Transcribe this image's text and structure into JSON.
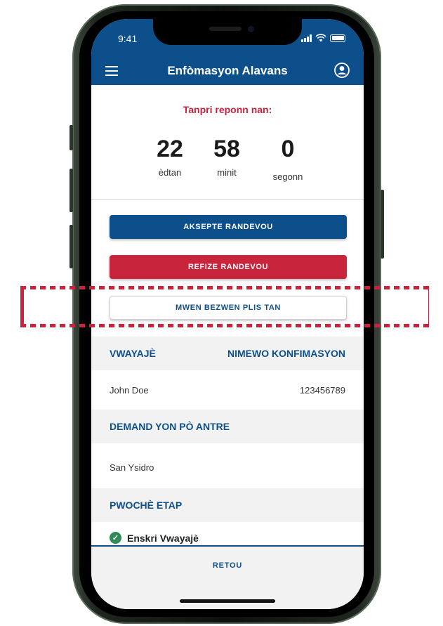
{
  "status_bar": {
    "time": "9:41"
  },
  "header": {
    "title": "Enfòmasyon Alavans"
  },
  "countdown": {
    "heading": "Tanpri reponn nan:",
    "hours": "22",
    "hours_label": "èdtan",
    "minutes": "58",
    "minutes_label": "minit",
    "seconds": "0",
    "seconds_label": "segonn"
  },
  "actions": {
    "accept_label": "AKSEPTE RANDEVOU",
    "decline_label": "REFIZE RANDEVOU",
    "more_time_label": "MWEN BEZWEN PLIS TAN"
  },
  "traveler": {
    "traveler_header": "VWAYAJÈ",
    "confirmation_header": "NIMEWO KONFIMASYON",
    "name": "John Doe",
    "confirmation_number": "123456789"
  },
  "entry_request": {
    "header": "DEMAND YON PÒ ANTRE",
    "port": "San Ysidro"
  },
  "next_step": {
    "header": "PWOCHÈ ETAP",
    "step_label": "Enskri Vwayajè"
  },
  "footer": {
    "back_label": "RETOU"
  },
  "colors": {
    "primary": "#0d4f8b",
    "danger": "#c8243b",
    "success": "#2e8b57"
  }
}
